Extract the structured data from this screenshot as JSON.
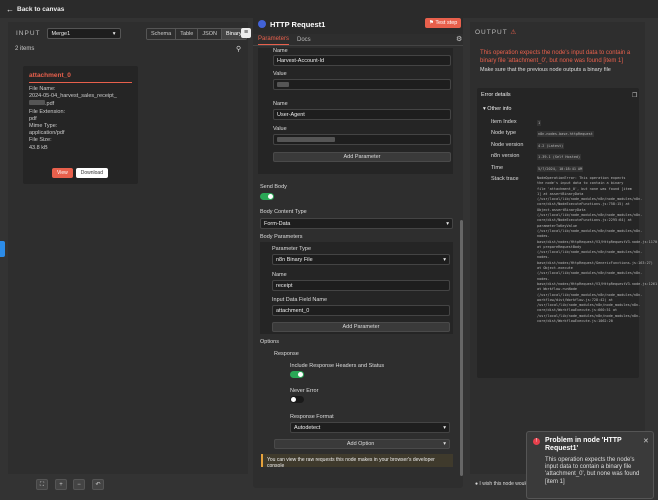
{
  "topbar": {
    "back_label": "Back to canvas"
  },
  "input_panel": {
    "caption": "INPUT",
    "source_node": "Merge1",
    "view_tabs": [
      "Schema",
      "Table",
      "JSON",
      "Binary"
    ],
    "item_count": "2 items",
    "card": {
      "title": "attachment_0",
      "file_name_label": "File Name:",
      "file_name_value": "2024-05-04_harvest_sales_receipt_",
      "file_name_suffix": ".pdf",
      "file_ext_label": "File Extension:",
      "file_ext_value": "pdf",
      "mime_label": "Mime Type:",
      "mime_value": "application/pdf",
      "size_label": "File Size:",
      "size_value": "43.8 kB",
      "view_label": "View",
      "download_label": "Download"
    }
  },
  "node": {
    "title": "HTTP Request1",
    "test_step_label": "Test step",
    "tabs": [
      "Parameters",
      "Docs"
    ],
    "headers": [
      {
        "name_label": "Name",
        "name_value": "Harvest-Account-Id",
        "value_label": "Value"
      },
      {
        "name_label": "Name",
        "name_value": "User-Agent",
        "value_label": "Value"
      }
    ],
    "add_parameter_label": "Add Parameter",
    "send_body_label": "Send Body",
    "body_content_type_label": "Body Content Type",
    "body_content_type_value": "Form-Data",
    "body_parameters_label": "Body Parameters",
    "parameter_type_label": "Parameter Type",
    "parameter_type_value": "n8n Binary File",
    "name_label": "Name",
    "name_value": "receipt",
    "input_field_label": "Input Data Field Name",
    "input_field_value": "attachment_0",
    "options_label": "Options",
    "response_label": "Response",
    "include_headers_label": "Include Response Headers and Status",
    "never_error_label": "Never Error",
    "response_format_label": "Response Format",
    "response_format_value": "Autodetect",
    "add_option_label": "Add Option",
    "notice": "You can view the raw requests this node makes in your browser's developer console"
  },
  "output_panel": {
    "caption": "OUTPUT",
    "error_message": "This operation expects the node's input data to contain a binary file 'attachment_0', but none was found [item 1]",
    "error_hint": "Make sure that the previous node outputs a binary file",
    "details_label": "Error details",
    "other_info_label": "Other info",
    "rows": [
      {
        "key": "Item Index",
        "value": "1"
      },
      {
        "key": "Node type",
        "value": "n8n-nodes-base.httpRequest"
      },
      {
        "key": "Node version",
        "value": "4.2 (Latest)"
      },
      {
        "key": "n8n version",
        "value": "1.39.1 (Self Hosted)"
      },
      {
        "key": "Time",
        "value": "5/7/2024, 10:18:41 AM"
      }
    ],
    "stack_label": "Stack trace",
    "stack_trace": "NodeOperationError: This operation expects the node's input data to contain a binary file 'attachment_0', but none was found [item 1] at assertBinaryData (/usr/local/lib/node_modules/n8n/node_modules/n8n-core/dist/NodeExecuteFunctions.js:758:15) at Object.assertBinaryData (/usr/local/lib/node_modules/n8n/node_modules/n8n-core/dist/NodeExecuteFunctions.js:2295:64) at parameterToKeyValue (/usr/local/lib/node_modules/n8n/node_modules/n8n-nodes-base/dist/nodes/HttpRequest/V3/HttpRequestV3.node.js:1170:32) at prepareRequestBody (/usr/local/lib/node_modules/n8n/node_modules/n8n-nodes-base/dist/nodes/HttpRequest/GenericFunctions.js:163:27) at Object.execute (/usr/local/lib/node_modules/n8n/node_modules/n8n-nodes-base/dist/nodes/HttpRequest/V3/HttpRequestV3.node.js:1261:52) at Workflow.runNode (/usr/local/lib/node_modules/n8n/node_modules/n8n-workflow/dist/Workflow.js:728:42) at /usr/local/lib/node_modules/n8n/node_modules/n8n-core/dist/WorkflowExecute.js:660:51 at /usr/local/lib/node_modules/n8n/node_modules/n8n-core/dist/WorkflowExecute.js:1062:20",
    "feedback": "I wish this node would"
  },
  "toast": {
    "title": "Problem in node 'HTTP Request1'",
    "message": "This operation expects the node's input data to contain a binary file 'attachment_0', but none was found [item 1]"
  }
}
